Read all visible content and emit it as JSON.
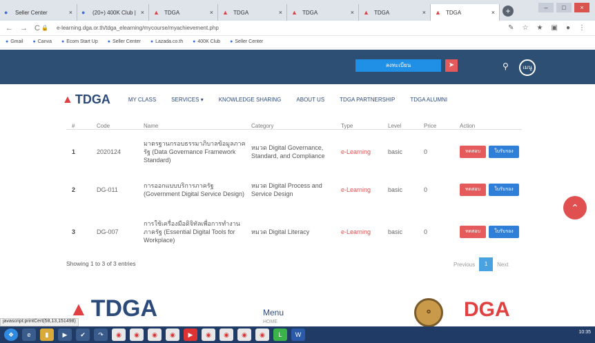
{
  "browser": {
    "tabs": [
      {
        "label": "Seller Center",
        "icon": "seller-center-icon"
      },
      {
        "label": "(20+) 400K Club |",
        "icon": "facebook-icon"
      },
      {
        "label": "TDGA",
        "icon": "tdga-icon"
      },
      {
        "label": "TDGA",
        "icon": "tdga-icon"
      },
      {
        "label": "TDGA",
        "icon": "tdga-icon"
      },
      {
        "label": "TDGA",
        "icon": "tdga-icon"
      },
      {
        "label": "TDGA",
        "icon": "tdga-icon"
      }
    ],
    "url": "e-learning.dga.or.th/tdga_elearning/mycourse/myachievement.php",
    "bookmarks": [
      "Gmail",
      "Canva",
      "Ecom Start Up",
      "Seller Center",
      "Lazada.co.th",
      "400K Club",
      "Seller Center"
    ]
  },
  "site": {
    "login_label": "ลงทะเบียน",
    "menu_short": "เมนู"
  },
  "nav": {
    "logo_text": "TDGA",
    "items": [
      "MY CLASS",
      "SERVICES ▾",
      "KNOWLEDGE SHARING",
      "ABOUT US",
      "TDGA PARTNERSHIP",
      "TDGA ALUMNI"
    ]
  },
  "table": {
    "headers": [
      "#",
      "Code",
      "Name",
      "Category",
      "Type",
      "Level",
      "Price",
      "Action"
    ],
    "rows": [
      {
        "no": "1",
        "code": "2020124",
        "name": "มาตรฐานกรอบธรรมาภิบาลข้อมูลภาครัฐ (Data Governance Framework Standard)",
        "category": "หมวด Digital Governance, Standard, and Compliance",
        "type": "e-Learning",
        "level": "basic",
        "price": "0",
        "btn_test": "ทดสอบ",
        "btn_cert": "ใบรับรอง"
      },
      {
        "no": "2",
        "code": "DG-011",
        "name": "การออกแบบบริการภาครัฐ (Government Digital Service Design)",
        "category": "หมวด Digital Process and Service Design",
        "type": "e-Learning",
        "level": "basic",
        "price": "0",
        "btn_test": "ทดสอบ",
        "btn_cert": "ใบรับรอง"
      },
      {
        "no": "3",
        "code": "DG-007",
        "name": "การใช้เครื่องมือดิจิทัลเพื่อการทำงานภาครัฐ (Essential Digital Tools for Workplace)",
        "category": "หมวด Digital Literacy",
        "type": "e-Learning",
        "level": "basic",
        "price": "0",
        "btn_test": "ทดสอบ",
        "btn_cert": "ใบรับรอง"
      }
    ],
    "summary": "Showing 1 to 3 of 3 entries",
    "pager": {
      "prev": "Previous",
      "current": "1",
      "next": "Next"
    }
  },
  "footer": {
    "logo_text": "TDGA",
    "menu_title": "Menu",
    "menu_home": "HOME",
    "dga_text": "DGA"
  },
  "status_url": "javascript:printCert(58,13,151498)",
  "taskbar": {
    "clock": "10:35"
  }
}
